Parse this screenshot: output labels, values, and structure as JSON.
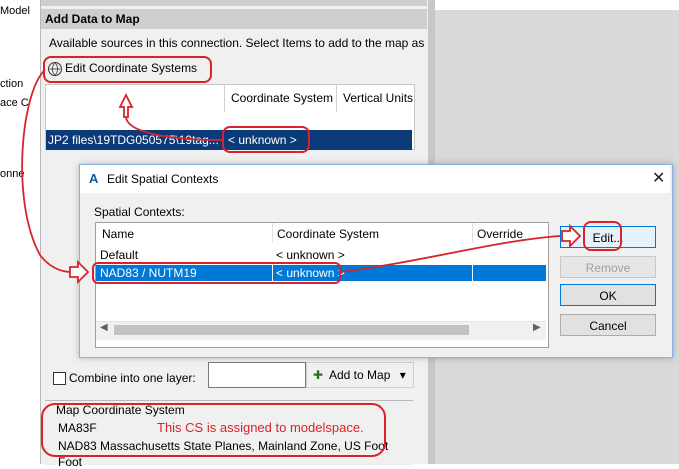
{
  "left_labels": [
    "Model",
    "ction",
    "ace C",
    "onne"
  ],
  "panel": {
    "title": "Add Data to Map",
    "available_text": "Available sources in this connection.  Select Items to add to the map as",
    "edit_cs_label": "Edit Coordinate Systems",
    "grid_headers": [
      "Coordinate System",
      "Vertical Units"
    ],
    "selected_row_text": "JP2 files\\19TDG050575\\19tag...",
    "selected_row_cs": "< unknown >"
  },
  "dialog": {
    "title": "Edit Spatial Contexts",
    "close": "✕",
    "spatial_contexts_label": "Spatial Contexts:",
    "columns": [
      "Name",
      "Coordinate System",
      "Override"
    ],
    "rows": [
      {
        "name": "Default",
        "cs": "< unknown >"
      },
      {
        "name": "NAD83 / NUTM19",
        "cs": "< unknown >"
      }
    ],
    "buttons": {
      "edit": "Edit...",
      "remove": "Remove",
      "ok": "OK",
      "cancel": "Cancel"
    }
  },
  "bottom": {
    "combine_label": "Combine into one layer:",
    "add_to_map": "Add to Map",
    "dropdown_arrow": "▾"
  },
  "map_cs": {
    "label": "Map Coordinate System",
    "code": "MA83F",
    "annotation": "This CS is assigned to modelspace.",
    "description": "NAD83 Massachusetts State Planes, Mainland Zone, US Foot",
    "units": "Foot"
  },
  "colors": {
    "annotation_red": "#d8232a",
    "selection_blue": "#0078d7",
    "dark_selection": "#0b3a79"
  }
}
